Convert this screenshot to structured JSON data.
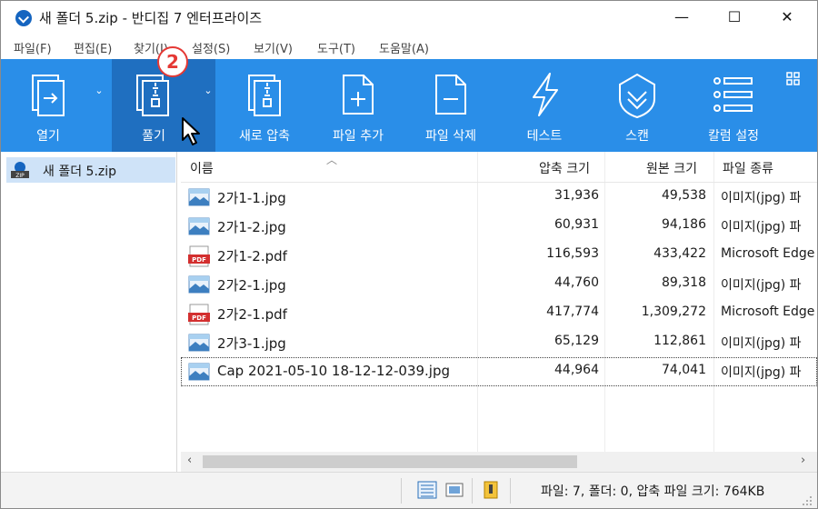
{
  "window": {
    "title": "새 폴더 5.zip - 반디집 7 엔터프라이즈",
    "minimize": "—",
    "maximize": "☐",
    "close": "✕"
  },
  "menu": [
    "파일(F)",
    "편집(E)",
    "찾기(I)",
    "설정(S)",
    "보기(V)",
    "도구(T)",
    "도움말(A)"
  ],
  "ribbon": {
    "open": "열기",
    "extract": "풀기",
    "new_archive": "새로 압축",
    "add_file": "파일 추가",
    "delete_file": "파일 삭제",
    "test": "테스트",
    "scan": "스캔",
    "columns": "칼럼 설정"
  },
  "annotation_badge": "2",
  "tree": {
    "root": "새 폴더 5.zip"
  },
  "columns": {
    "name": "이름",
    "compressed": "압축 크기",
    "original": "원본 크기",
    "type": "파일 종류"
  },
  "files": [
    {
      "name": "2가1-1.jpg",
      "compressed": "31,936",
      "original": "49,538",
      "type": "이미지(jpg) 파",
      "icon": "image-icon"
    },
    {
      "name": "2가1-2.jpg",
      "compressed": "60,931",
      "original": "94,186",
      "type": "이미지(jpg) 파",
      "icon": "image-icon"
    },
    {
      "name": "2가1-2.pdf",
      "compressed": "116,593",
      "original": "433,422",
      "type": "Microsoft Edge",
      "icon": "pdf-icon"
    },
    {
      "name": "2가2-1.jpg",
      "compressed": "44,760",
      "original": "89,318",
      "type": "이미지(jpg) 파",
      "icon": "image-icon"
    },
    {
      "name": "2가2-1.pdf",
      "compressed": "417,774",
      "original": "1,309,272",
      "type": "Microsoft Edge",
      "icon": "pdf-icon"
    },
    {
      "name": "2가3-1.jpg",
      "compressed": "65,129",
      "original": "112,861",
      "type": "이미지(jpg) 파",
      "icon": "image-icon"
    },
    {
      "name": "Cap 2021-05-10 18-12-12-039.jpg",
      "compressed": "44,964",
      "original": "74,041",
      "type": "이미지(jpg) 파",
      "icon": "image-icon"
    }
  ],
  "status": {
    "text": "파일: 7, 폴더: 0, 압축 파일 크기: 764KB"
  },
  "colors": {
    "ribbon": "#2a8ee8",
    "ribbon_active": "#1f6fc0",
    "selection": "#cfe3f8",
    "badge": "#e53935"
  }
}
